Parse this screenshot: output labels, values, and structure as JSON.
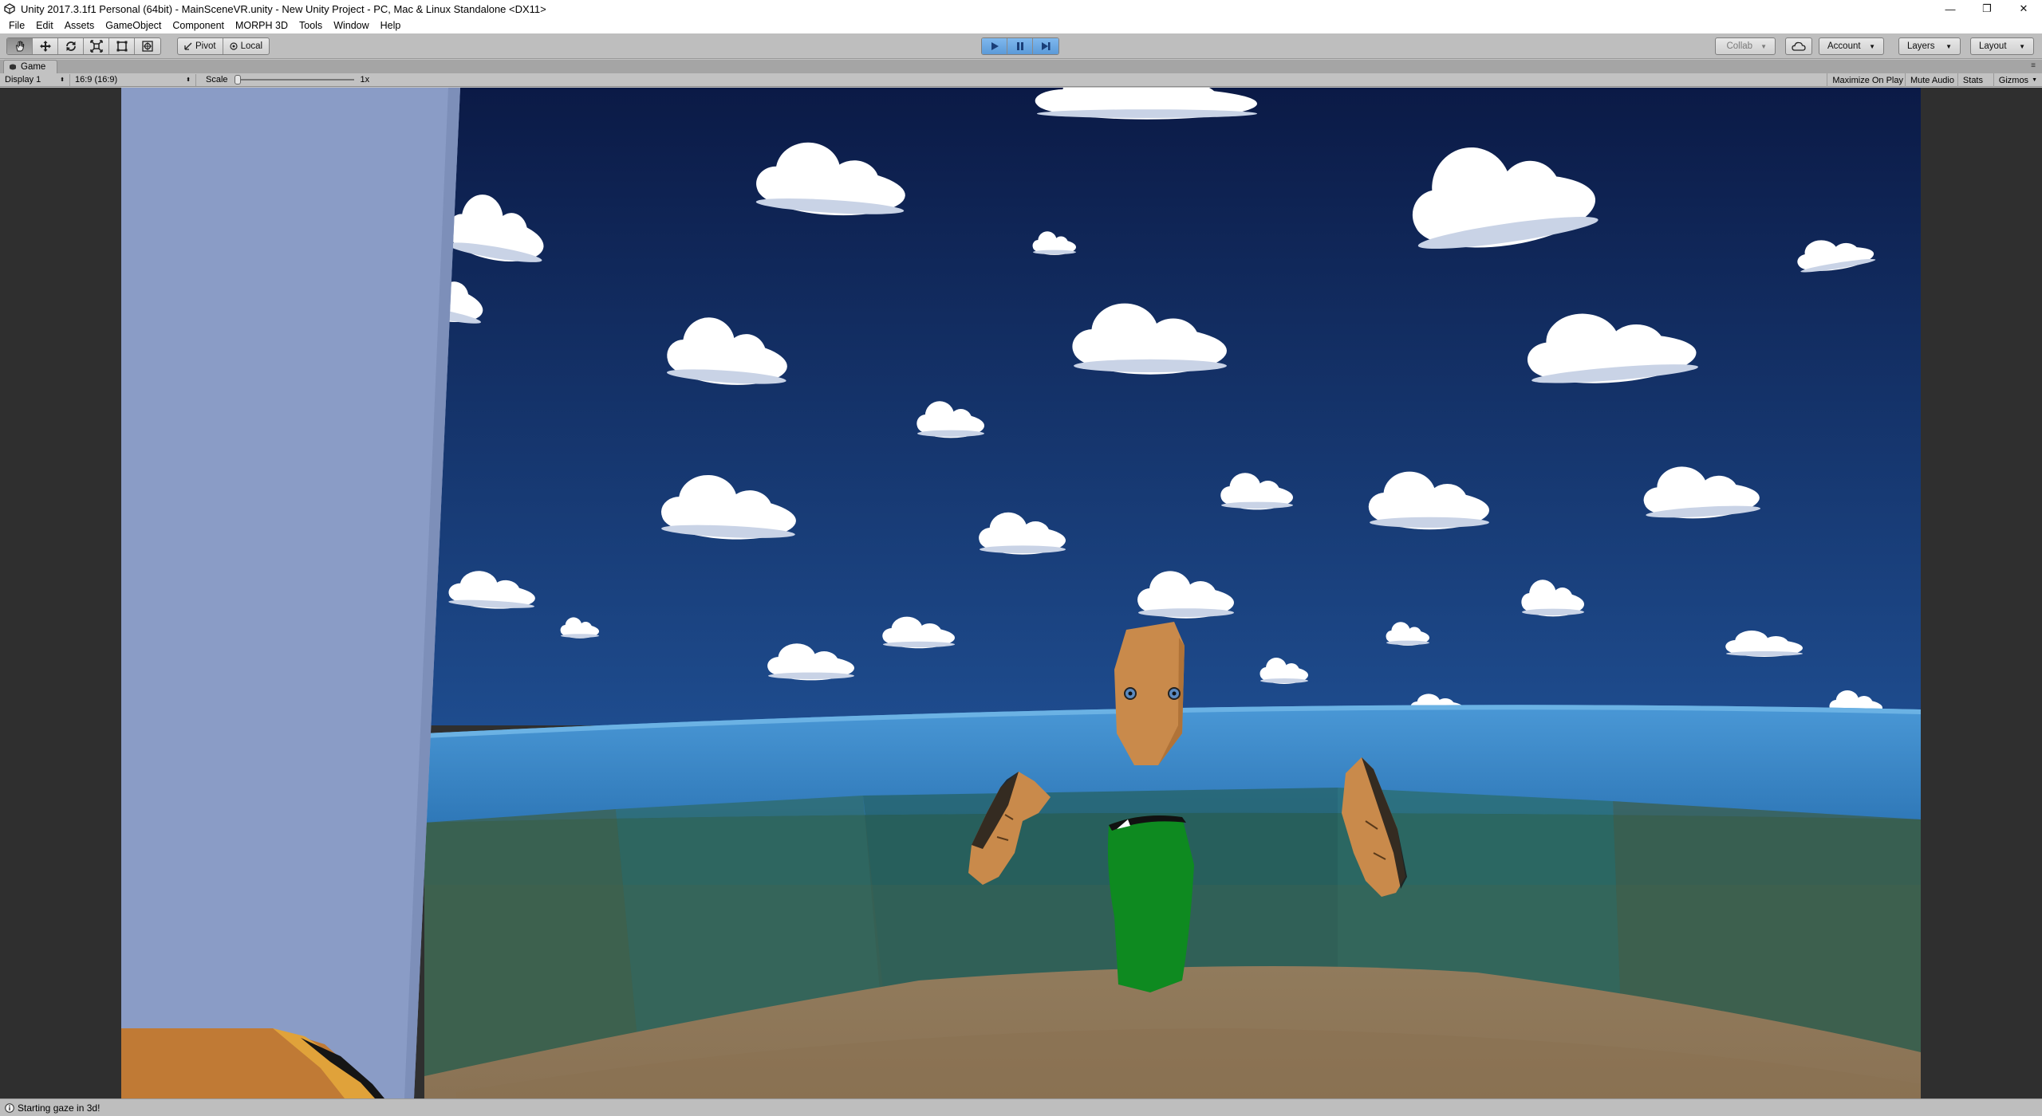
{
  "window": {
    "title": "Unity 2017.3.1f1 Personal (64bit) - MainSceneVR.unity - New Unity Project - PC, Mac & Linux Standalone <DX11>",
    "controls": {
      "minimize": "—",
      "restore": "❐",
      "close": "✕"
    }
  },
  "menu": {
    "items": [
      "File",
      "Edit",
      "Assets",
      "GameObject",
      "Component",
      "MORPH 3D",
      "Tools",
      "Window",
      "Help"
    ]
  },
  "toolbar": {
    "tools": [
      {
        "name": "hand-tool",
        "icon": "hand-icon"
      },
      {
        "name": "move-tool",
        "icon": "move-icon"
      },
      {
        "name": "rotate-tool",
        "icon": "rotate-icon"
      },
      {
        "name": "scale-tool",
        "icon": "scale-icon"
      },
      {
        "name": "rect-tool",
        "icon": "rect-icon"
      },
      {
        "name": "transform-tool",
        "icon": "transform-icon"
      }
    ],
    "pivot_label": "Pivot",
    "local_label": "Local",
    "collab_label": "Collab",
    "account_label": "Account",
    "layers_label": "Layers",
    "layout_label": "Layout",
    "play_state": "playing",
    "accent_color": "#5b9ad8"
  },
  "game_view": {
    "tab_label": "Game",
    "tab_menu": "≡",
    "display_label": "Display 1",
    "aspect_label": "16:9 (16:9)",
    "scale_label": "Scale",
    "scale_value": "1x",
    "maximize_label": "Maximize On Play",
    "mute_label": "Mute Audio",
    "stats_label": "Stats",
    "gizmos_label": "Gizmos"
  },
  "scene_colors": {
    "sky_top": "#0d1d4c",
    "sky_bottom": "#1d4a8a",
    "water": "#3a88c4",
    "wall": "#2f5e5a",
    "floor": "#8c7656",
    "skin": "#c98a4b",
    "shirt": "#0c8a1f",
    "pillar": "#8a9cc6"
  },
  "status": {
    "message": "Starting gaze in 3d!"
  }
}
